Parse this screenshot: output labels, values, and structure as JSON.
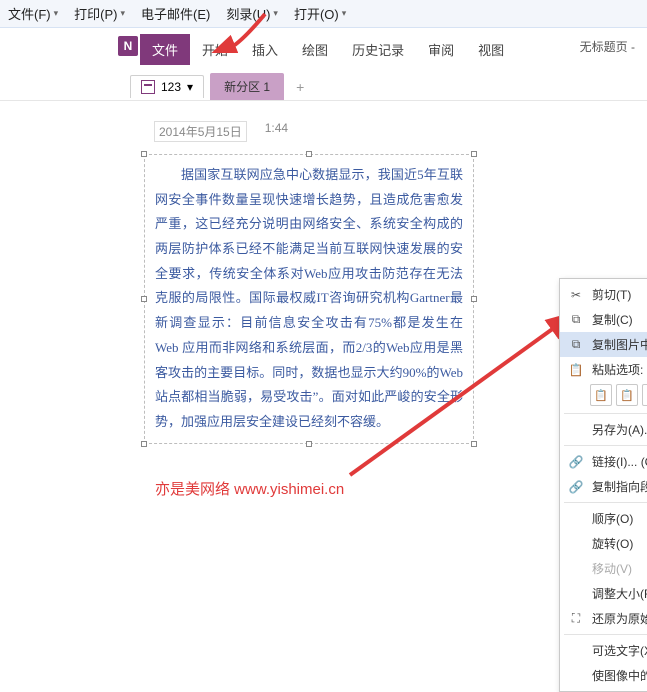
{
  "top_menu": {
    "file": "文件(F)",
    "print": "打印(P)",
    "email": "电子邮件(E)",
    "burn": "刻录(U)",
    "open": "打开(O)"
  },
  "title_right": "无标题页 -",
  "ribbon": {
    "file": "文件",
    "home": "开始",
    "insert": "插入",
    "draw": "绘图",
    "history": "历史记录",
    "review": "审阅",
    "view": "视图"
  },
  "notebook_name": "123",
  "section_name": "新分区 1",
  "date": "2014年5月15日",
  "time": "1:44",
  "paragraph": "据国家互联网应急中心数据显示，我国近5年互联网安全事件数量呈现快速增长趋势，且造成危害愈发严重，这已经充分说明由网络安全、系统安全构成的两层防护体系已经不能满足当前互联网快速发展的安全要求，传统安全体系对Web应用攻击防范存在无法克服的局限性。国际最权威IT咨询研究机构Gartner最新调查显示：目前信息安全攻击有75%都是发生在 Web 应用而非网络和系统层面，而2/3的Web应用是黑客攻击的主要目标。同时，数据也显示大约90%的Web站点都相当脆弱，易受攻击”。面对如此严峻的安全形势，加强应用层安全建设已经刻不容缓。",
  "watermark": "亦是美网络 www.yishimei.cn",
  "ctx": {
    "cut": "剪切(T)",
    "copy": "复制(C)",
    "copy_text": "复制图片中的文本(E)",
    "paste_opts": "粘贴选项:",
    "save_as": "另存为(A)...",
    "link": "链接(I)...",
    "link_sc": "(Ctrl+K)",
    "copy_link_para": "复制指向段落的链接(P)",
    "order": "顺序(O)",
    "rotate": "旋转(O)",
    "move": "移动(V)",
    "resize": "调整大小(R)",
    "restore": "还原为原始尺寸",
    "alt_text": "可选文字(X)...",
    "ocr": "使图像中的文本可搜索(K)"
  }
}
